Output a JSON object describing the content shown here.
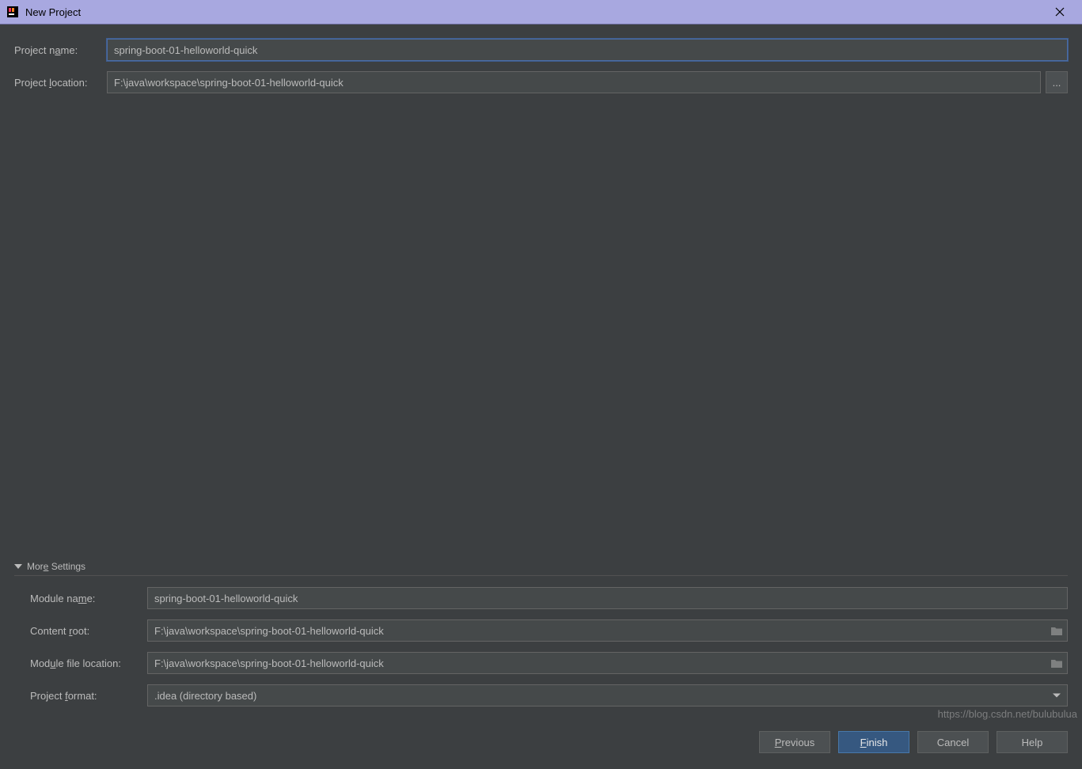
{
  "window": {
    "title": "New Project"
  },
  "form": {
    "project_name_label_pre": "Project n",
    "project_name_label_ul": "a",
    "project_name_label_post": "me:",
    "project_name_value": "spring-boot-01-helloworld-quick",
    "project_location_label_pre": "Project ",
    "project_location_label_ul": "l",
    "project_location_label_post": "ocation:",
    "project_location_value": "F:\\java\\workspace\\spring-boot-01-helloworld-quick",
    "browse_label": "..."
  },
  "more": {
    "header_pre": "Mor",
    "header_ul": "e",
    "header_post": " Settings",
    "module_name_label_pre": "Module na",
    "module_name_label_ul": "m",
    "module_name_label_post": "e:",
    "module_name_value": "spring-boot-01-helloworld-quick",
    "content_root_label_pre": "Content ",
    "content_root_label_ul": "r",
    "content_root_label_post": "oot:",
    "content_root_value": "F:\\java\\workspace\\spring-boot-01-helloworld-quick",
    "module_file_label_pre": "Mod",
    "module_file_label_ul": "u",
    "module_file_label_post": "le file location:",
    "module_file_value": "F:\\java\\workspace\\spring-boot-01-helloworld-quick",
    "project_format_label_pre": "Project ",
    "project_format_label_ul": "f",
    "project_format_label_post": "ormat:",
    "project_format_value": ".idea (directory based)"
  },
  "buttons": {
    "previous_ul": "P",
    "previous_post": "revious",
    "finish_ul": "F",
    "finish_post": "inish",
    "cancel": "Cancel",
    "help": "Help"
  },
  "watermark": "https://blog.csdn.net/bulubulua"
}
